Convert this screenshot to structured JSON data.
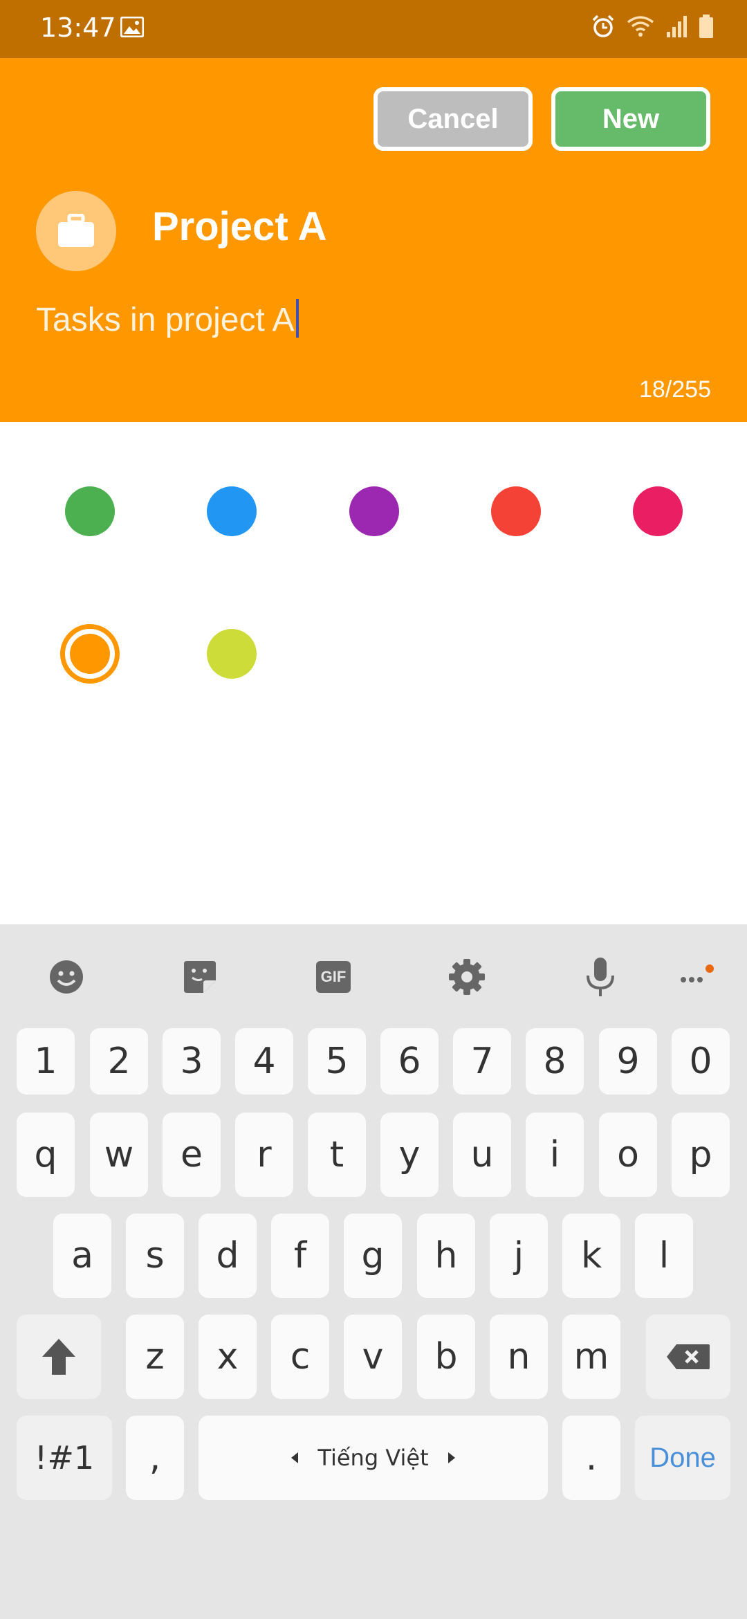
{
  "status_bar": {
    "time": "13:47"
  },
  "header": {
    "cancel_label": "Cancel",
    "new_label": "New",
    "project_title": "Project A",
    "description": "Tasks in project A",
    "char_counter": "18/255",
    "icon": "briefcase-icon",
    "background_color": "#ff9800"
  },
  "color_palette": {
    "colors": [
      "#4caf50",
      "#2196f3",
      "#9c27b0",
      "#f44336",
      "#e91e63",
      "#ff9800",
      "#cddc39"
    ],
    "selected": "#ff9800"
  },
  "keyboard": {
    "toolbar": [
      "emoji-icon",
      "sticker-icon",
      "gif-icon",
      "settings-icon",
      "microphone-icon",
      "more-icon"
    ],
    "gif_label": "GIF",
    "row_numbers": [
      "1",
      "2",
      "3",
      "4",
      "5",
      "6",
      "7",
      "8",
      "9",
      "0"
    ],
    "row_1": [
      "q",
      "w",
      "e",
      "r",
      "t",
      "y",
      "u",
      "i",
      "o",
      "p"
    ],
    "row_2": [
      "a",
      "s",
      "d",
      "f",
      "g",
      "h",
      "j",
      "k",
      "l"
    ],
    "row_3": [
      "z",
      "x",
      "c",
      "v",
      "b",
      "n",
      "m"
    ],
    "symbols_label": "!#1",
    "comma_label": ",",
    "space_label": "Tiếng Việt",
    "period_label": ".",
    "done_label": "Done"
  }
}
